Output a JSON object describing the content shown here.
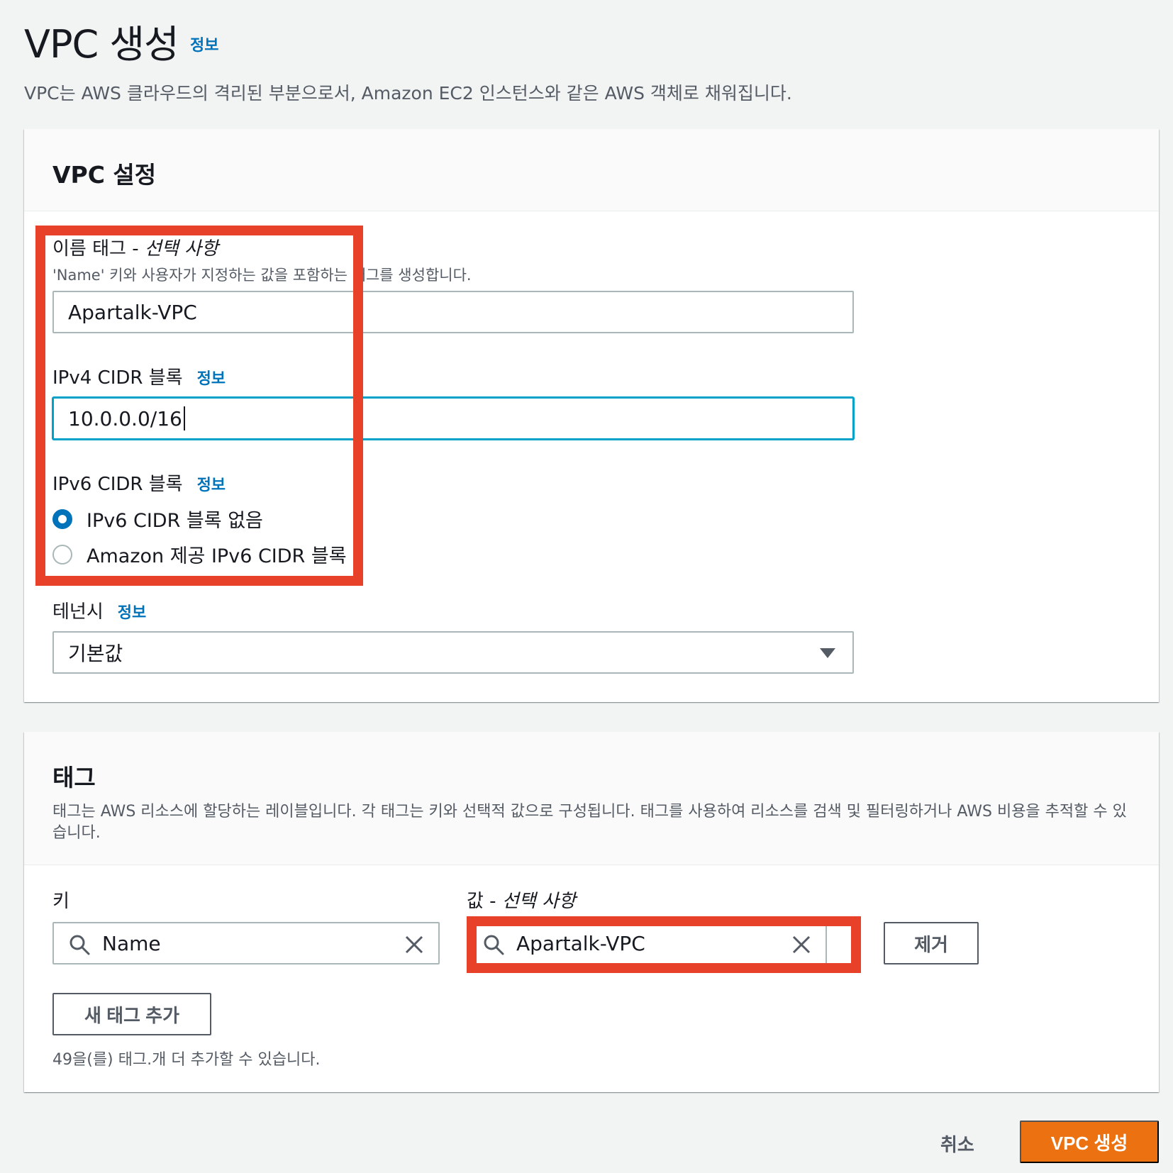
{
  "header": {
    "title": "VPC 생성",
    "info": "정보",
    "description": "VPC는 AWS 클라우드의 격리된 부분으로서, Amazon EC2 인스턴스와 같은 AWS 객체로 채워집니다."
  },
  "vpc_settings": {
    "title": "VPC 설정",
    "name_tag": {
      "label": "이름 태그 - ",
      "label_optional": "선택 사항",
      "description": "'Name' 키와 사용자가 지정하는 값을 포함하는 태그를 생성합니다.",
      "value": "Apartalk-VPC"
    },
    "ipv4": {
      "label": "IPv4 CIDR 블록",
      "info": "정보",
      "value": "10.0.0.0/16"
    },
    "ipv6": {
      "label": "IPv6 CIDR 블록",
      "info": "정보",
      "options": [
        {
          "label": "IPv6 CIDR 블록 없음",
          "selected": true
        },
        {
          "label": "Amazon 제공 IPv6 CIDR 블록",
          "selected": false
        }
      ]
    },
    "tenancy": {
      "label": "테넌시",
      "info": "정보",
      "value": "기본값"
    }
  },
  "tags": {
    "title": "태그",
    "description": "태그는 AWS 리소스에 할당하는 레이블입니다. 각 태그는 키와 선택적 값으로 구성됩니다. 태그를 사용하여 리소스를 검색 및 필터링하거나 AWS 비용을 추적할 수 있습니다.",
    "key_label": "키",
    "value_label": "값 - ",
    "value_label_optional": "선택 사항",
    "key_value": "Name",
    "value_value": "Apartalk-VPC",
    "remove_button": "제거",
    "add_button": "새 태그 추가",
    "remaining": "49을(를) 태그.개 더 추가할 수 있습니다."
  },
  "footer": {
    "cancel": "취소",
    "submit": "VPC 생성"
  },
  "colors": {
    "accent": "#0073bb",
    "primary_button": "#ec7211",
    "highlight": "#e8412a",
    "focus_border": "#00a1c9"
  }
}
